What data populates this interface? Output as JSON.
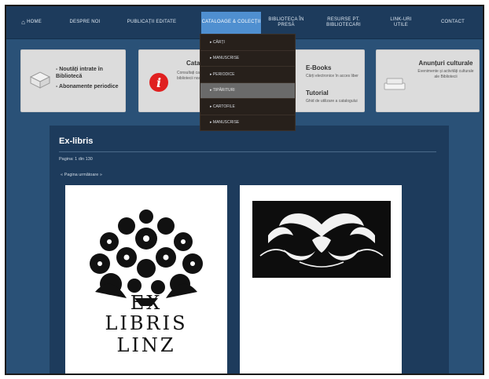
{
  "nav": {
    "home": "Home",
    "items": [
      "Despre noi",
      "Publicații editate",
      "Cataloage & colecții",
      "Biblioteca în presă",
      "Resurse pt. bibliotecari",
      "Link-uri utile",
      "Contact"
    ]
  },
  "dropdown": {
    "items": [
      "Cărți",
      "Manuscrise",
      "Periodice",
      "Tipărituri",
      "Cartofile",
      "Manuscrise"
    ]
  },
  "boxes": {
    "box1": {
      "line1": "- Noutăți intrate în Bibliotecă",
      "line2": "- Abonamente periodice"
    },
    "box2": {
      "title": "Catalog",
      "text": "Consultați catalogul online al bibliotecii noastre"
    },
    "box3": {
      "title": "E-Books",
      "text": "Cărți electronice în acces liber",
      "title2": "Tutorial",
      "text2": "Ghid de utilizare a catalogului"
    },
    "box4": {
      "title": "Anunțuri culturale",
      "text": "Evenimente și activități culturale ale Bibliotecii"
    }
  },
  "main": {
    "title": "Ex-libris",
    "page_info": "Pagina: 1 din 130",
    "prev_link": "« Pagina următoare »",
    "card1": {
      "line1": "EX",
      "line2": "LIBRIS",
      "line3": "LINZ",
      "num": "1"
    },
    "card2": {
      "num": "10"
    }
  },
  "colors": {
    "background": "#2a5177",
    "nav": "#1d3b5c",
    "active_tab": "#4f8fd0",
    "dropdown": "#27201b",
    "box": "#dcdcdc",
    "info_icon": "#e02020"
  }
}
